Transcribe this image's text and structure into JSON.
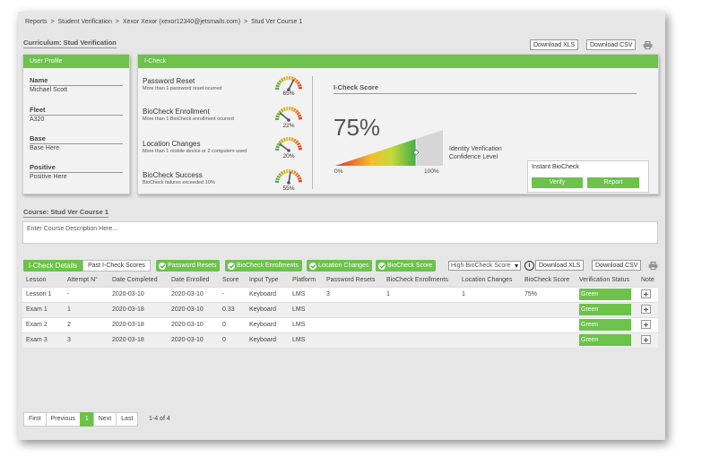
{
  "breadcrumb": {
    "items": [
      "Reports",
      "Student Verification",
      "Xexor Xexor (xexor12340@jetsmails.com)",
      "Stud Ver Course 1"
    ],
    "separator": ">"
  },
  "curriculum_title": "Curriculum: Stud Verification",
  "top_actions": {
    "download_xls": "Download XLS",
    "download_csv": "Download CSV",
    "print_icon": "printer-icon"
  },
  "profile": {
    "header": "User Profile",
    "fields": [
      {
        "label": "Name",
        "value": "Michael Scott"
      },
      {
        "label": "Fleet",
        "value": "A320"
      },
      {
        "label": "Base",
        "value": "Base Here"
      },
      {
        "label": "Positive",
        "value": "Positive Here"
      }
    ]
  },
  "icheck": {
    "header": "I-Check",
    "metrics": [
      {
        "title": "Password Reset",
        "subtitle": "More than 1 password reset ocurred",
        "percent": "65%",
        "value": 0.65
      },
      {
        "title": "BioCheck Enrollment",
        "subtitle": "More than 1 BioCheck enrollment ocurred",
        "percent": "22%",
        "value": 0.22
      },
      {
        "title": "Location Changes",
        "subtitle": "More than 1 mobile device or 2 computers used",
        "percent": "20%",
        "value": 0.2
      },
      {
        "title": "BioCheck Success",
        "subtitle": "BioCheck failures exceeded 10%",
        "percent": "55%",
        "value": 0.55
      }
    ],
    "score_title": "I-Check Score",
    "score": "75%",
    "score_value": 0.75,
    "scale_min": "0%",
    "scale_max": "100%",
    "confidence_line1": "Identity Verification",
    "confidence_line2": "Confidence Level",
    "instant": {
      "title": "Instant BioCheck",
      "verify": "Verify",
      "report": "Report"
    }
  },
  "course": {
    "title": "Course: Stud Ver Course 1",
    "description_placeholder": "Enter Course Description Here..."
  },
  "details": {
    "tab_active": "I-Check Details",
    "tab_other": "Past I-Check Scores",
    "filters": [
      "Password Resets",
      "BioCheck Enrollments",
      "Location Changes",
      "BioCheck Score"
    ],
    "sort_select": "High BioCheck Score",
    "info_icon": "info-icon",
    "download_xls": "Download XLS",
    "download_csv": "Download CSV",
    "columns": [
      "Lesson",
      "Attempt N°",
      "Date Completed",
      "Date Enrolled",
      "Score",
      "Input Type",
      "Platform",
      "Password Resets",
      "BioCheck Enrollments",
      "Location Changes",
      "BioCheck Score",
      "Verification Status",
      "Note"
    ],
    "rows": [
      [
        "Lesson 1",
        "-",
        "2020-03-10",
        "2020-03-10",
        "-",
        "Keyboard",
        "LMS",
        "3",
        "1",
        "1",
        "75%",
        "Green"
      ],
      [
        "Exam 1",
        "1",
        "2020-03-18",
        "2020-03-10",
        "0.33",
        "Keyboard",
        "LMS",
        "",
        "",
        "",
        "",
        "Green"
      ],
      [
        "Exam 2",
        "2",
        "2020-03-18",
        "2020-03-10",
        "0",
        "Keyboard",
        "LMS",
        "",
        "",
        "",
        "",
        "Green"
      ],
      [
        "Exam 3",
        "3",
        "2020-03-18",
        "2020-03-10",
        "0",
        "Keyboard",
        "LMS",
        "",
        "",
        "",
        "",
        "Green"
      ]
    ]
  },
  "pagination": {
    "first": "First",
    "previous": "Previous",
    "current": "1",
    "next": "Next",
    "last": "Last",
    "summary": "1-4 of 4"
  },
  "colors": {
    "accent": "#6cc24a",
    "gauge_low": "#3fae49",
    "gauge_mid": "#f2c02c",
    "gauge_high": "#e0322b"
  }
}
